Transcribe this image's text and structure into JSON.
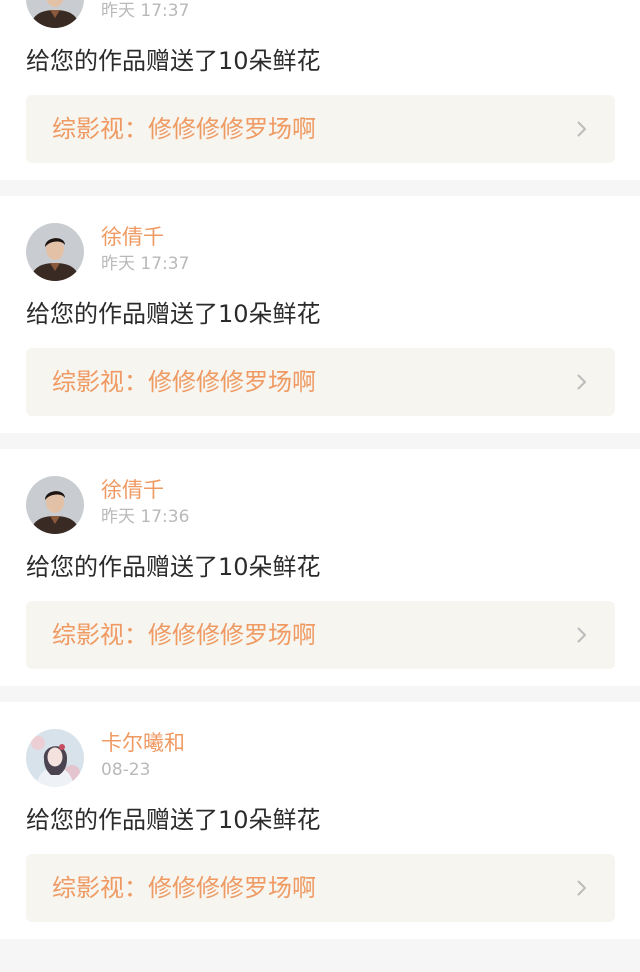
{
  "colors": {
    "accent": "#ef9a63",
    "timestamp": "#b9b9b9",
    "message": "#2b2b2b",
    "link_background": "#f6f5ef",
    "page_background": "#f6f6f6"
  },
  "notifications": [
    {
      "avatar": "male-portrait",
      "username": "",
      "timestamp": "昨天 17:37",
      "message": "给您的作品赠送了10朵鲜花",
      "work_title": "综影视：修修修修罗场啊",
      "chevron_icon": "chevron-right-icon"
    },
    {
      "avatar": "male-portrait",
      "username": "徐倩千",
      "timestamp": "昨天 17:37",
      "message": "给您的作品赠送了10朵鲜花",
      "work_title": "综影视：修修修修罗场啊",
      "chevron_icon": "chevron-right-icon"
    },
    {
      "avatar": "male-portrait",
      "username": "徐倩千",
      "timestamp": "昨天 17:36",
      "message": "给您的作品赠送了10朵鲜花",
      "work_title": "综影视：修修修修罗场啊",
      "chevron_icon": "chevron-right-icon"
    },
    {
      "avatar": "female-illustration",
      "username": "卡尔曦和",
      "timestamp": "08-23",
      "message": "给您的作品赠送了10朵鲜花",
      "work_title": "综影视：修修修修罗场啊",
      "chevron_icon": "chevron-right-icon"
    }
  ]
}
